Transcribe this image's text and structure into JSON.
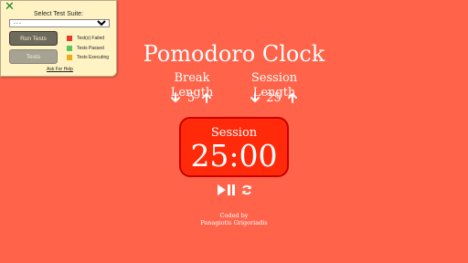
{
  "test_panel": {
    "title": "Select Test Suite:",
    "suite_selected": "- - -",
    "run_button": "Run Tests",
    "tests_button": "Tests",
    "legend": [
      {
        "label": "Test(s) Failed",
        "color": "#e53b2c"
      },
      {
        "label": "Tests Passed",
        "color": "#55c855"
      },
      {
        "label": "Tests Executing",
        "color": "#f0a81e"
      }
    ],
    "help_link": "Ask For Help",
    "close_icon": "close-x-icon"
  },
  "clock": {
    "title": "Pomodoro Clock",
    "break_label": "Break Length",
    "break_length": "5",
    "session_label": "Session Length",
    "session_length": "25",
    "timer_label": "Session",
    "time_left": "25:00",
    "credit_line1": "Coded by",
    "credit_line2": "Panagiotis Grigoriadis"
  },
  "colors": {
    "background": "#ff644a",
    "timer_fill": "#ff2a0a",
    "timer_border": "#c80000",
    "panel_bg": "#fff3c4"
  }
}
